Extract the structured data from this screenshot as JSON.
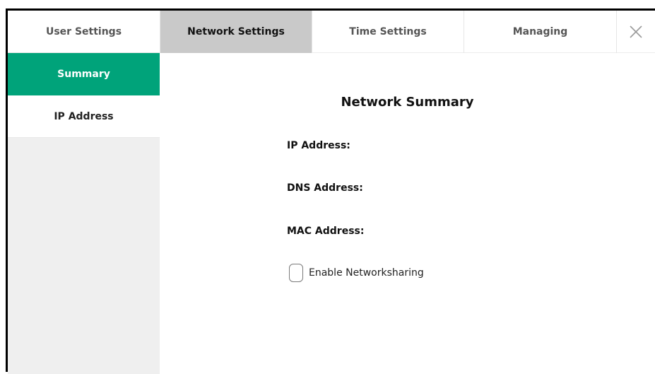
{
  "tabs": [
    {
      "label": "User Settings",
      "active": false
    },
    {
      "label": "Network Settings",
      "active": true
    },
    {
      "label": "Time Settings",
      "active": false
    },
    {
      "label": "Managing",
      "active": false
    }
  ],
  "close_icon": "close-icon",
  "sidebar": {
    "items": [
      {
        "label": "Summary",
        "active": true
      },
      {
        "label": "IP Address",
        "active": false
      }
    ]
  },
  "main": {
    "title": "Network Summary",
    "fields": {
      "ip_label": "IP Address:",
      "ip_value": "",
      "dns_label": "DNS Address:",
      "dns_value": "",
      "mac_label": "MAC Address:",
      "mac_value": ""
    },
    "networksharing": {
      "label": "Enable Networksharing",
      "checked": false
    }
  },
  "colors": {
    "accent": "#00a37a",
    "active_tab": "#c9c9c9",
    "sidebar_bg": "#efefef"
  }
}
